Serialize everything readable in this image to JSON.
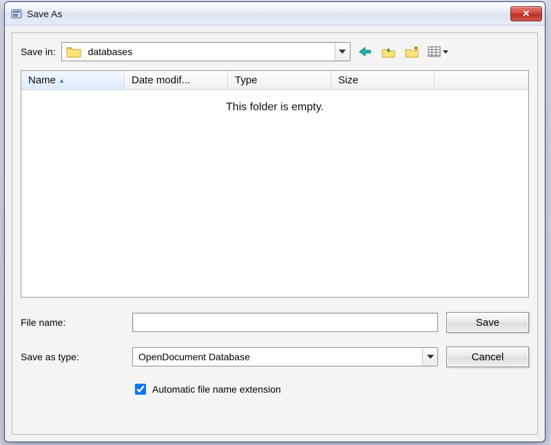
{
  "title": "Save As",
  "save_in_label": "Save in:",
  "current_folder": "databases",
  "nav_icons": {
    "back": "back-arrow-icon",
    "up": "up-folder-icon",
    "new": "new-folder-icon",
    "view": "view-menu-icon"
  },
  "columns": {
    "name": "Name",
    "date": "Date modif...",
    "type": "Type",
    "size": "Size"
  },
  "empty_message": "This folder is empty.",
  "file_name_label": "File name:",
  "file_name_value": "",
  "save_as_type_label": "Save as type:",
  "save_as_type_value": "OpenDocument Database",
  "auto_ext_label": "Automatic file name extension",
  "auto_ext_checked": true,
  "buttons": {
    "save": "Save",
    "cancel": "Cancel",
    "close": "✕"
  }
}
